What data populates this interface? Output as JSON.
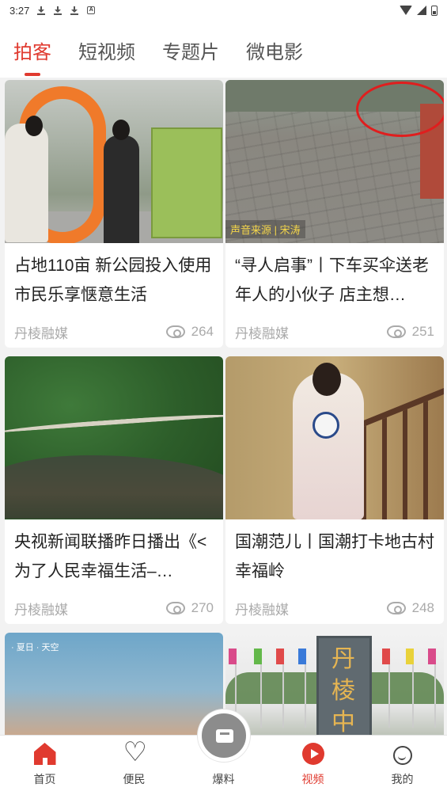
{
  "status_bar": {
    "time": "3:27"
  },
  "tabs": [
    {
      "label": "拍客",
      "active": true
    },
    {
      "label": "短视频",
      "active": false
    },
    {
      "label": "专题片",
      "active": false
    },
    {
      "label": "微电影",
      "active": false
    }
  ],
  "cards": [
    {
      "title": "占地110亩 新公园投入使用 市民乐享惬意生活",
      "source": "丹棱融媒",
      "views": "264"
    },
    {
      "title": "“寻人启事”丨下车买伞送老年人的小伙子 店主想…",
      "source": "丹棱融媒",
      "views": "251",
      "caption": "声音来源 | 宋涛"
    },
    {
      "title": "央视新闻联播昨日播出《<为了人民幸福生活–…",
      "source": "丹棱融媒",
      "views": "270"
    },
    {
      "title": "国潮范儿丨国潮打卡地古村幸福岭",
      "source": "丹棱融媒",
      "views": "248"
    },
    {
      "title": "",
      "source": "",
      "views": "",
      "tag": "· 夏日 · 天空"
    },
    {
      "title": "",
      "source": "",
      "views": "",
      "monument_text": "丹棱中"
    }
  ],
  "bottom_nav": [
    {
      "label": "首页",
      "icon": "home-icon",
      "active": false
    },
    {
      "label": "便民",
      "icon": "heart-icon",
      "active": false
    },
    {
      "label": "爆料",
      "icon": "mail-icon",
      "active": false
    },
    {
      "label": "视频",
      "icon": "play-icon",
      "active": true
    },
    {
      "label": "我的",
      "icon": "person-icon",
      "active": false
    }
  ],
  "colors": {
    "accent": "#e03a2f",
    "muted": "#aaaaaa",
    "background": "#f2f2f2"
  }
}
